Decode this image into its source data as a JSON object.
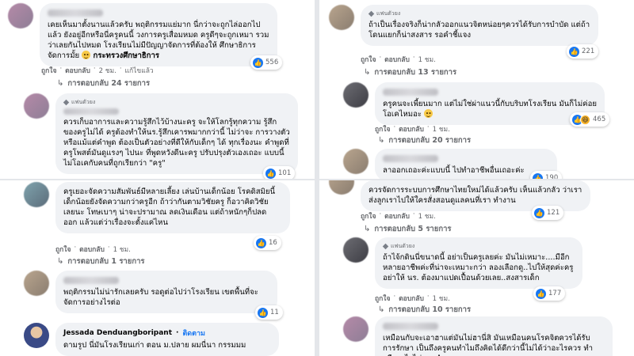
{
  "labels": {
    "like": "ถูกใจ",
    "reply": "ตอบกลับ",
    "edited": "แก้ไขแล้ว",
    "fan_badge": "แฟนตัวยง",
    "follow": "ติดตาม"
  },
  "panel_tl": {
    "c1": {
      "text_a": "เคยเห็นมาตั้งนานแล้วครับ พฤติกรรมแย่มาก นี่กว่าจะถูกไล่ออกไป แล้ว ยังอยู่อีกหรือนี่ครูคนนี้ วงการครูเสื่อมหมด ครูดีๆจะถูกเหมา รวมว่าเลยกันไปหมด โรงเรียนไม่มีปัญญาจัดการที่ต้องให้ ศึกษาธิการจัดการมั้ย",
      "text_b": " กระทรวงศึกษาธิการ",
      "reactions": "556",
      "time": "2 ชม.",
      "replies": "การตอบกลับ 24 รายการ"
    },
    "c2": {
      "text": "ควรเก็บอาการและความรู้สึกไว้บ้างนะครู จะให้โลกรู้ทุกความ รู้สึกของครูไม่ได้ ครูต้องทำให้นร.รู้สึกเคารพมากกว่านี้ ไม่ว่าจะ การวางตัวหรือแม้แต่คำพูด ต้องเป็นตัวอย่างที่ดีให้กับเด็กๆ ได้ ทุกเรื่องนะ คำพูดที่ครูโพสต์มันดูแรงๆ ไปนะ ที่พูดหวังดีนะครู ปรับปรุงตัวเองเถอะ แบบนี้ไม่โอเคกับคนที่ถูกเรียกว่า \"ครู\"",
      "reactions": "101"
    }
  },
  "panel_tr": {
    "c1": {
      "text": "ถ้าเป็นเรื่องจริงก็น่ากลัวออกแนวจิตหน่อยๆควรได้รับการบำบัด แต่ถ้าโดนแยกก็น่าสงสาร รอคำชี้แจง",
      "reactions": "221",
      "time": "1 ชม.",
      "replies": "การตอบกลับ 13 รายการ"
    },
    "c2": {
      "text": "ครูคนจะเพี้ยนมาก แต่ไม่ใช่ผ่าแนวนี้กับบริบทโรงเรียน มันก็ไม่ค่อย โอเคไหมอะ",
      "reactions": "465",
      "time": "1 ชม.",
      "replies": "การตอบกลับ 20 รายการ"
    },
    "c3": {
      "text": "ลาออกเถอะค่ะแบบนี้ ไปทำอาชีพอื่นเถอะค่ะ",
      "reactions": "190"
    }
  },
  "panel_bl": {
    "c1": {
      "text": "ครูเยอะจัดความสัมพันธ์มีหลายเลี้ยง เล่นบ้านเด็กน้อย โรคดิสมิยนี้ เด็กน้อยยังจัดความกว่าครูอีก ถ้าว่ากันตามวิชัยครู ก็อวาคิดวิชัย เลยนะ โทษเบาๆ น่าจะปรามาณ ลดเงินเดือน แต่ถ้าหนักๆก็ปลด ออก แล้วแต่ว่าเรื่องจะตั้งแค่ไหน",
      "reactions": "16",
      "time": "1 ชม.",
      "replies": "การตอบกลับ 1 รายการ"
    },
    "c2": {
      "text": "พฤติกรรมไม่น่ารักเลยครับ รอดูต่อไปว่าโรงเรียน เขตพื้นที่จะ จัดการอย่างไรต่อ",
      "reactions": "11"
    },
    "c3": {
      "name": "Jessada Denduangboripant",
      "text": "ดามรูป นี่มันโรงเรียนเก่า ตอน ม.ปลาย ผมนี่นา กรรมมม"
    }
  },
  "panel_br": {
    "c1": {
      "text": "ควรจัดการระบบการศึกษาไทยใหม่ได้แล้วครับ เห็นแล้วกลัว ว่าเราส่งลูกเราไปให้ใครสั่งสอนดูแลคนที่เรา ทำงาน",
      "reactions": "121",
      "time": "1 ชม.",
      "replies": "การตอบกลับ 5 รายการ"
    },
    "c2": {
      "text": "ถ้าไจ้กดินนี่ขนาดนี้ อย่าเป็นครูเลยค่ะ มันไม่เหมาะ....มีอีก หลายอาชีพค่ะที่น่าจะเหมาะกว่า ลองเลือกดู..ไปให้สุดค่ะครู อย่าให้ นร. ต้องมาแปดเปื้อนด้วยเลย..สงสารเด็ก",
      "reactions": "177",
      "time": "1 ชม.",
      "replies": "การตอบกลับ 10 รายการ"
    },
    "c3": {
      "text": "เหมือนกับจะเอาฮาแต่มันไม่ฮานี่สิ มันเหมือนคนโรคจิตควรได้รับ การรักษา เป็นถึงครูคนทำไมถึงคิดได้ดีกว่านี้ไม่ได้ว่าอะไรควร ทำหรือจะไรไม่ควรทำ"
    }
  }
}
